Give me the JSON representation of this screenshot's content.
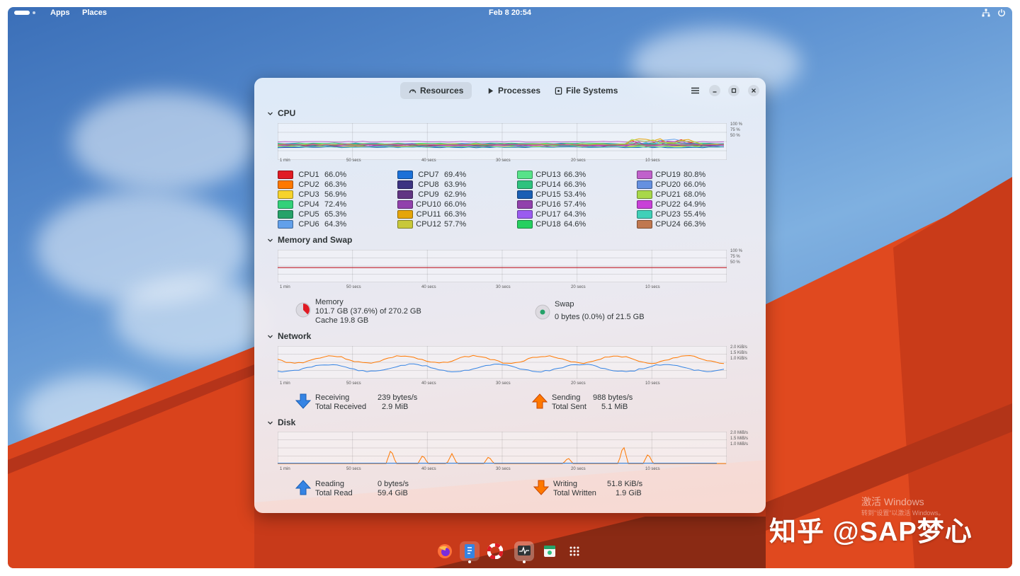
{
  "topbar": {
    "apps": "Apps",
    "places": "Places",
    "clock": "Feb 8  20:54"
  },
  "tabs": [
    {
      "label": "Resources",
      "icon": "gauge-icon",
      "active": true
    },
    {
      "label": "Processes",
      "icon": "play-icon",
      "active": false
    },
    {
      "label": "File Systems",
      "icon": "disk-icon",
      "active": false
    }
  ],
  "time_ticks": [
    "1 min",
    "50 secs",
    "40 secs",
    "30 secs",
    "20 secs",
    "10 secs"
  ],
  "cpu": {
    "title": "CPU",
    "scale": [
      "100 %",
      "75 %",
      "50 %"
    ],
    "cores": [
      {
        "name": "CPU1",
        "value": "66.0%",
        "color": "#e01b24"
      },
      {
        "name": "CPU2",
        "value": "66.3%",
        "color": "#ff7800"
      },
      {
        "name": "CPU3",
        "value": "56.9%",
        "color": "#f6d32d"
      },
      {
        "name": "CPU4",
        "value": "72.4%",
        "color": "#33d17a"
      },
      {
        "name": "CPU5",
        "value": "65.3%",
        "color": "#26a269"
      },
      {
        "name": "CPU6",
        "value": "64.3%",
        "color": "#62a0ea"
      },
      {
        "name": "CPU7",
        "value": "69.4%",
        "color": "#1c71d8"
      },
      {
        "name": "CPU8",
        "value": "63.9%",
        "color": "#3d3482"
      },
      {
        "name": "CPU9",
        "value": "62.9%",
        "color": "#613583"
      },
      {
        "name": "CPU10",
        "value": "66.0%",
        "color": "#9141ac"
      },
      {
        "name": "CPU11",
        "value": "66.3%",
        "color": "#e5a50a"
      },
      {
        "name": "CPU12",
        "value": "57.7%",
        "color": "#c8c83a"
      },
      {
        "name": "CPU13",
        "value": "66.3%",
        "color": "#57e389"
      },
      {
        "name": "CPU14",
        "value": "66.3%",
        "color": "#2ec27e"
      },
      {
        "name": "CPU15",
        "value": "53.4%",
        "color": "#1a5fb4"
      },
      {
        "name": "CPU16",
        "value": "57.4%",
        "color": "#9141ac"
      },
      {
        "name": "CPU17",
        "value": "64.3%",
        "color": "#9a5bf0"
      },
      {
        "name": "CPU18",
        "value": "64.6%",
        "color": "#26d060"
      },
      {
        "name": "CPU19",
        "value": "80.8%",
        "color": "#c061cb"
      },
      {
        "name": "CPU20",
        "value": "66.0%",
        "color": "#6590e0"
      },
      {
        "name": "CPU21",
        "value": "68.0%",
        "color": "#a8d84a"
      },
      {
        "name": "CPU22",
        "value": "64.9%",
        "color": "#c840d8"
      },
      {
        "name": "CPU23",
        "value": "55.4%",
        "color": "#40d0b8"
      },
      {
        "name": "CPU24",
        "value": "66.3%",
        "color": "#c07850"
      }
    ]
  },
  "memory": {
    "title": "Memory and Swap",
    "scale": [
      "100 %",
      "75 %",
      "50 %"
    ],
    "memory_label": "Memory",
    "memory_used": "101.7 GB (37.6%) of 270.2 GB",
    "cache": "Cache 19.8 GB",
    "memory_fraction": 0.376,
    "swap_label": "Swap",
    "swap_used": "0 bytes (0.0%) of 21.5 GB",
    "swap_fraction": 0.0
  },
  "network": {
    "title": "Network",
    "scale": [
      "2.0 KiB/s",
      "1.5 KiB/s",
      "1.0 KiB/s"
    ],
    "receiving_label": "Receiving",
    "receiving_value": "239 bytes/s",
    "total_received_label": "Total Received",
    "total_received_value": "2.9 MiB",
    "sending_label": "Sending",
    "sending_value": "988 bytes/s",
    "total_sent_label": "Total Sent",
    "total_sent_value": "5.1 MiB"
  },
  "disk": {
    "title": "Disk",
    "scale": [
      "2.0 MiB/s",
      "1.5 MiB/s",
      "1.0 MiB/s"
    ],
    "reading_label": "Reading",
    "reading_value": "0 bytes/s",
    "total_read_label": "Total Read",
    "total_read_value": "59.4 GiB",
    "writing_label": "Writing",
    "writing_value": "51.8 KiB/s",
    "total_written_label": "Total Written",
    "total_written_value": "1.9 GiB"
  },
  "dock": [
    {
      "name": "firefox-icon",
      "running": false
    },
    {
      "name": "text-editor-icon",
      "running": true
    },
    {
      "name": "help-icon",
      "running": false
    },
    {
      "name": "system-monitor-icon",
      "running": true
    },
    {
      "name": "software-store-icon",
      "running": false
    },
    {
      "name": "app-grid-icon",
      "running": false
    }
  ],
  "watermark": "知乎 @SAP梦心",
  "activation": {
    "title": "激活 Windows",
    "subtitle": "转到\"设置\"以激活 Windows。"
  }
}
